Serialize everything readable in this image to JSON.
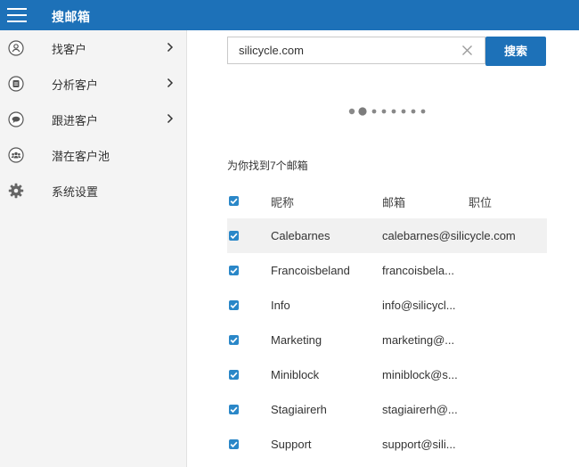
{
  "topbar": {
    "title": "搜邮箱"
  },
  "sidebar": {
    "items": [
      {
        "label": "找客户",
        "icon": "user-icon",
        "has_submenu": true
      },
      {
        "label": "分析客户",
        "icon": "document-icon",
        "has_submenu": true
      },
      {
        "label": "跟进客户",
        "icon": "chat-icon",
        "has_submenu": true
      },
      {
        "label": "潜在客户池",
        "icon": "group-icon",
        "has_submenu": false
      },
      {
        "label": "系统设置",
        "icon": "gear-icon",
        "has_submenu": false
      }
    ]
  },
  "search": {
    "value": "silicycle.com",
    "button_label": "搜索"
  },
  "results": {
    "summary": "为你找到7个邮箱",
    "columns": {
      "nickname": "昵称",
      "email": "邮箱",
      "position": "职位"
    },
    "rows": [
      {
        "nickname": "Calebarnes",
        "email": "calebarnes@silicycle.com",
        "position": "",
        "checked": true
      },
      {
        "nickname": "Francoisbeland",
        "email": "francoisbela...",
        "position": "",
        "checked": true
      },
      {
        "nickname": "Info",
        "email": "info@silicycl...",
        "position": "",
        "checked": true
      },
      {
        "nickname": "Marketing",
        "email": "marketing@...",
        "position": "",
        "checked": true
      },
      {
        "nickname": "Miniblock",
        "email": "miniblock@s...",
        "position": "",
        "checked": true
      },
      {
        "nickname": "Stagiairerh",
        "email": "stagiairerh@...",
        "position": "",
        "checked": true
      },
      {
        "nickname": "Support",
        "email": "support@sili...",
        "position": "",
        "checked": true
      }
    ]
  },
  "colors": {
    "accent": "#1d71b8",
    "checkbox": "#2a87c8",
    "sidebar_bg": "#f4f4f4",
    "highlight_row": "#f1f1f1"
  }
}
